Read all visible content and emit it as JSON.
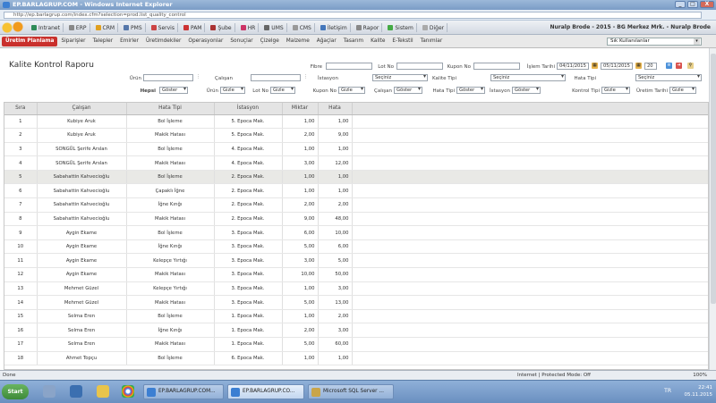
{
  "window": {
    "title": "EP.BARLAGRUP.COM - Windows Internet Explorer",
    "url": "http://ep.barlagrup.com/index.cfm?selection=prod.list_quality_control",
    "controls": [
      "_",
      "□",
      "X"
    ]
  },
  "topmenu": {
    "items": [
      {
        "label": "Intranet",
        "color": "#2e8b57"
      },
      {
        "label": "ERP",
        "color": "#888888"
      },
      {
        "label": "CRM",
        "color": "#e0a020"
      },
      {
        "label": "PMS",
        "color": "#5577aa"
      },
      {
        "label": "Servis",
        "color": "#cc4444"
      },
      {
        "label": "PAM",
        "color": "#cc3333"
      },
      {
        "label": "Şube",
        "color": "#aa3333"
      },
      {
        "label": "HR",
        "color": "#cc3366"
      },
      {
        "label": "UMS",
        "color": "#666666"
      },
      {
        "label": "CMS",
        "color": "#999999"
      },
      {
        "label": "İletişim",
        "color": "#4477bb"
      },
      {
        "label": "Rapor",
        "color": "#888888"
      },
      {
        "label": "Sistem",
        "color": "#44aa44"
      },
      {
        "label": "Diğer",
        "color": "#aaaaaa"
      }
    ],
    "user": "Nuralp Brode - 2015 - BG Merkez Mrk. - Nuralp Brode"
  },
  "modules": {
    "tabs": [
      "Üretim Planlama",
      "Siparişler",
      "Talepler",
      "Emirler",
      "Üretimdekiler",
      "Operasyonlar",
      "Sonuçlar",
      "Çizelge",
      "Malzeme",
      "Ağaçlar",
      "Tasarım",
      "Kalite",
      "E-Tekstil",
      "Tanımlar"
    ],
    "user_select": "Sık Kullanılanlar"
  },
  "report": {
    "title": "Kalite Kontrol Raporu",
    "filters": {
      "fibre_label": "Fibre",
      "lot_label": "Lot No",
      "kupon_label": "Kupon No",
      "islem_tarihi_label": "İşlem Tarihi",
      "date_start": "04/11/2015",
      "date_end": "05/11/2015",
      "page_size": "20",
      "urun_label": "Ürün",
      "calisan_label": "Çalışan",
      "istasyon_label": "İstasyon",
      "istasyon_value": "Seçiniz",
      "kalite_tipi_label": "Kalite Tipi",
      "kalite_tipi_value": "Seçiniz",
      "hata_tipi_label": "Hata Tipi",
      "hata_tipi_value": "Seçiniz"
    },
    "display_row": {
      "hepsi_label": "Hepsi",
      "hepsi_value": "Göster",
      "urun_label": "Ürün",
      "urun_value": "Gizle",
      "lot_label": "Lot No",
      "lot_value": "Gizle",
      "kupon_label": "Kupon No",
      "kupon_value": "Gizle",
      "calisan_label": "Çalışan",
      "calisan_value": "Göster",
      "hata_tipi_label": "Hata Tipi",
      "hata_tipi_value": "Göster",
      "istasyon_label": "İstasyon",
      "istasyon_value": "Göster",
      "kontrol_label": "Kontrol Tipi",
      "kontrol_value": "Gizle",
      "uretim_label": "Üretim Tarihi",
      "uretim_value": "Gizle"
    },
    "columns": [
      "Sıra",
      "Çalışan",
      "Hata Tipi",
      "İstasyon",
      "Miktar",
      "Hata"
    ],
    "rows": [
      {
        "no": "1",
        "calisan": "Kubiye Aruk",
        "hata_tipi": "Bol İşleme",
        "istasyon": "5. Epoca Mak.",
        "miktar": "1,00",
        "hata": "1,00"
      },
      {
        "no": "2",
        "calisan": "Kubiye Aruk",
        "hata_tipi": "Makik Hatası",
        "istasyon": "5. Epoca Mak.",
        "miktar": "2,00",
        "hata": "9,00"
      },
      {
        "no": "3",
        "calisan": "SONGÜL Şerife Arslan",
        "hata_tipi": "Bol İşleme",
        "istasyon": "4. Epoca Mak.",
        "miktar": "1,00",
        "hata": "1,00"
      },
      {
        "no": "4",
        "calisan": "SONGÜL Şerife Arslan",
        "hata_tipi": "Makik Hatası",
        "istasyon": "4. Epoca Mak.",
        "miktar": "3,00",
        "hata": "12,00"
      },
      {
        "no": "5",
        "calisan": "Sabahattin Kahvecioğlu",
        "hata_tipi": "Bol İşleme",
        "istasyon": "2. Epoca Mak.",
        "miktar": "1,00",
        "hata": "1,00"
      },
      {
        "no": "6",
        "calisan": "Sabahattin Kahvecioğlu",
        "hata_tipi": "Çapaklı İğne",
        "istasyon": "2. Epoca Mak.",
        "miktar": "1,00",
        "hata": "1,00"
      },
      {
        "no": "7",
        "calisan": "Sabahattin Kahvecioğlu",
        "hata_tipi": "İğne Kırığı",
        "istasyon": "2. Epoca Mak.",
        "miktar": "2,00",
        "hata": "2,00"
      },
      {
        "no": "8",
        "calisan": "Sabahattin Kahvecioğlu",
        "hata_tipi": "Makik Hatası",
        "istasyon": "2. Epoca Mak.",
        "miktar": "9,00",
        "hata": "48,00"
      },
      {
        "no": "9",
        "calisan": "Aygin Ekame",
        "hata_tipi": "Bol İşleme",
        "istasyon": "3. Epoca Mak.",
        "miktar": "6,00",
        "hata": "10,00"
      },
      {
        "no": "10",
        "calisan": "Aygin Ekame",
        "hata_tipi": "İğne Kırığı",
        "istasyon": "3. Epoca Mak.",
        "miktar": "5,00",
        "hata": "6,00"
      },
      {
        "no": "11",
        "calisan": "Aygin Ekame",
        "hata_tipi": "Kelepçe Yırtığı",
        "istasyon": "3. Epoca Mak.",
        "miktar": "3,00",
        "hata": "5,00"
      },
      {
        "no": "12",
        "calisan": "Aygin Ekame",
        "hata_tipi": "Makik Hatası",
        "istasyon": "3. Epoca Mak.",
        "miktar": "10,00",
        "hata": "50,00"
      },
      {
        "no": "13",
        "calisan": "Mehmet Güzel",
        "hata_tipi": "Kelepçe Yırtığı",
        "istasyon": "3. Epoca Mak.",
        "miktar": "1,00",
        "hata": "3,00"
      },
      {
        "no": "14",
        "calisan": "Mehmet Güzel",
        "hata_tipi": "Makik Hatası",
        "istasyon": "3. Epoca Mak.",
        "miktar": "5,00",
        "hata": "13,00"
      },
      {
        "no": "15",
        "calisan": "Selma Eren",
        "hata_tipi": "Bol İşleme",
        "istasyon": "1. Epoca Mak.",
        "miktar": "1,00",
        "hata": "2,00"
      },
      {
        "no": "16",
        "calisan": "Selma Eren",
        "hata_tipi": "İğne Kırığı",
        "istasyon": "1. Epoca Mak.",
        "miktar": "2,00",
        "hata": "3,00"
      },
      {
        "no": "17",
        "calisan": "Selma Eren",
        "hata_tipi": "Makik Hatası",
        "istasyon": "1. Epoca Mak.",
        "miktar": "5,00",
        "hata": "60,00"
      },
      {
        "no": "18",
        "calisan": "Ahmet Topçu",
        "hata_tipi": "Bol İşleme",
        "istasyon": "6. Epoca Mak.",
        "miktar": "1,00",
        "hata": "1,00"
      }
    ]
  },
  "statusbar": {
    "left": "Done",
    "zone": "Internet | Protected Mode: Off",
    "zoom": "100%"
  },
  "taskbar": {
    "start": "Start",
    "tasks": [
      "EP.BARLAGRUP.COM...",
      "EP.BARLAGRUP.CO...",
      "Microsoft SQL Server ..."
    ],
    "lang": "TR",
    "time": "22:41",
    "date": "05.11.2015"
  }
}
